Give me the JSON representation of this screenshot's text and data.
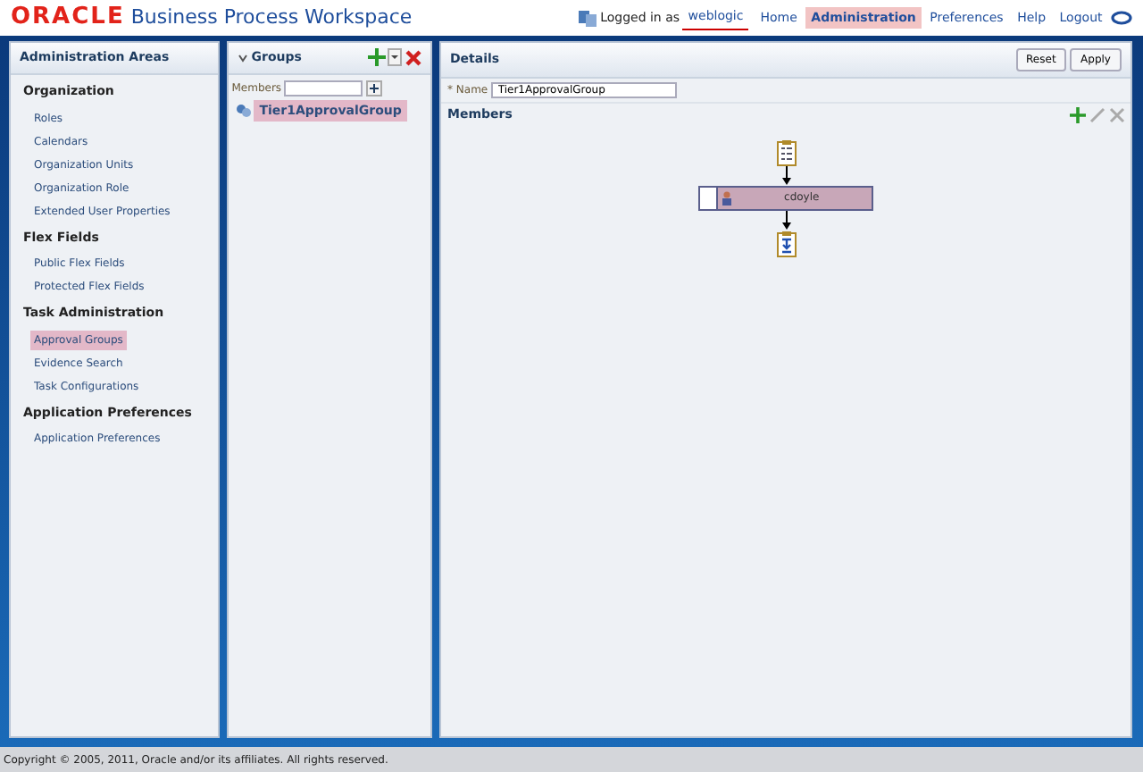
{
  "header": {
    "logo": "ORACLE",
    "title": "Business Process Workspace",
    "logged_in_label": "Logged in as",
    "user": "weblogic",
    "nav": [
      {
        "label": "Home",
        "selected": false
      },
      {
        "label": "Administration",
        "selected": true
      },
      {
        "label": "Preferences",
        "selected": false
      },
      {
        "label": "Help",
        "selected": false
      },
      {
        "label": "Logout",
        "selected": false
      }
    ]
  },
  "sidebar": {
    "title": "Administration Areas",
    "sections": [
      {
        "label": "Organization",
        "items": [
          {
            "label": "Roles",
            "selected": false
          },
          {
            "label": "Calendars",
            "selected": false
          },
          {
            "label": "Organization Units",
            "selected": false
          },
          {
            "label": "Organization Role",
            "selected": false
          },
          {
            "label": "Extended User Properties",
            "selected": false
          }
        ]
      },
      {
        "label": "Flex Fields",
        "items": [
          {
            "label": "Public Flex Fields",
            "selected": false
          },
          {
            "label": "Protected Flex Fields",
            "selected": false
          }
        ]
      },
      {
        "label": "Task Administration",
        "items": [
          {
            "label": "Approval Groups",
            "selected": true
          },
          {
            "label": "Evidence Search",
            "selected": false
          },
          {
            "label": "Task Configurations",
            "selected": false
          }
        ]
      },
      {
        "label": "Application Preferences",
        "items": [
          {
            "label": "Application Preferences",
            "selected": false
          }
        ]
      }
    ]
  },
  "groups": {
    "title": "Groups",
    "search_label": "Members",
    "items": [
      {
        "label": "Tier1ApprovalGroup",
        "selected": true
      }
    ]
  },
  "details": {
    "title": "Details",
    "buttons": [
      "Reset",
      "Apply"
    ],
    "name_label": "* Name",
    "name_value": "Tier1ApprovalGroup",
    "members_title": "Members",
    "members": [
      {
        "label": "cdoyle",
        "selected": true
      }
    ]
  },
  "footer": "Copyright © 2005, 2011, Oracle and/or its affiliates. All rights reserved."
}
